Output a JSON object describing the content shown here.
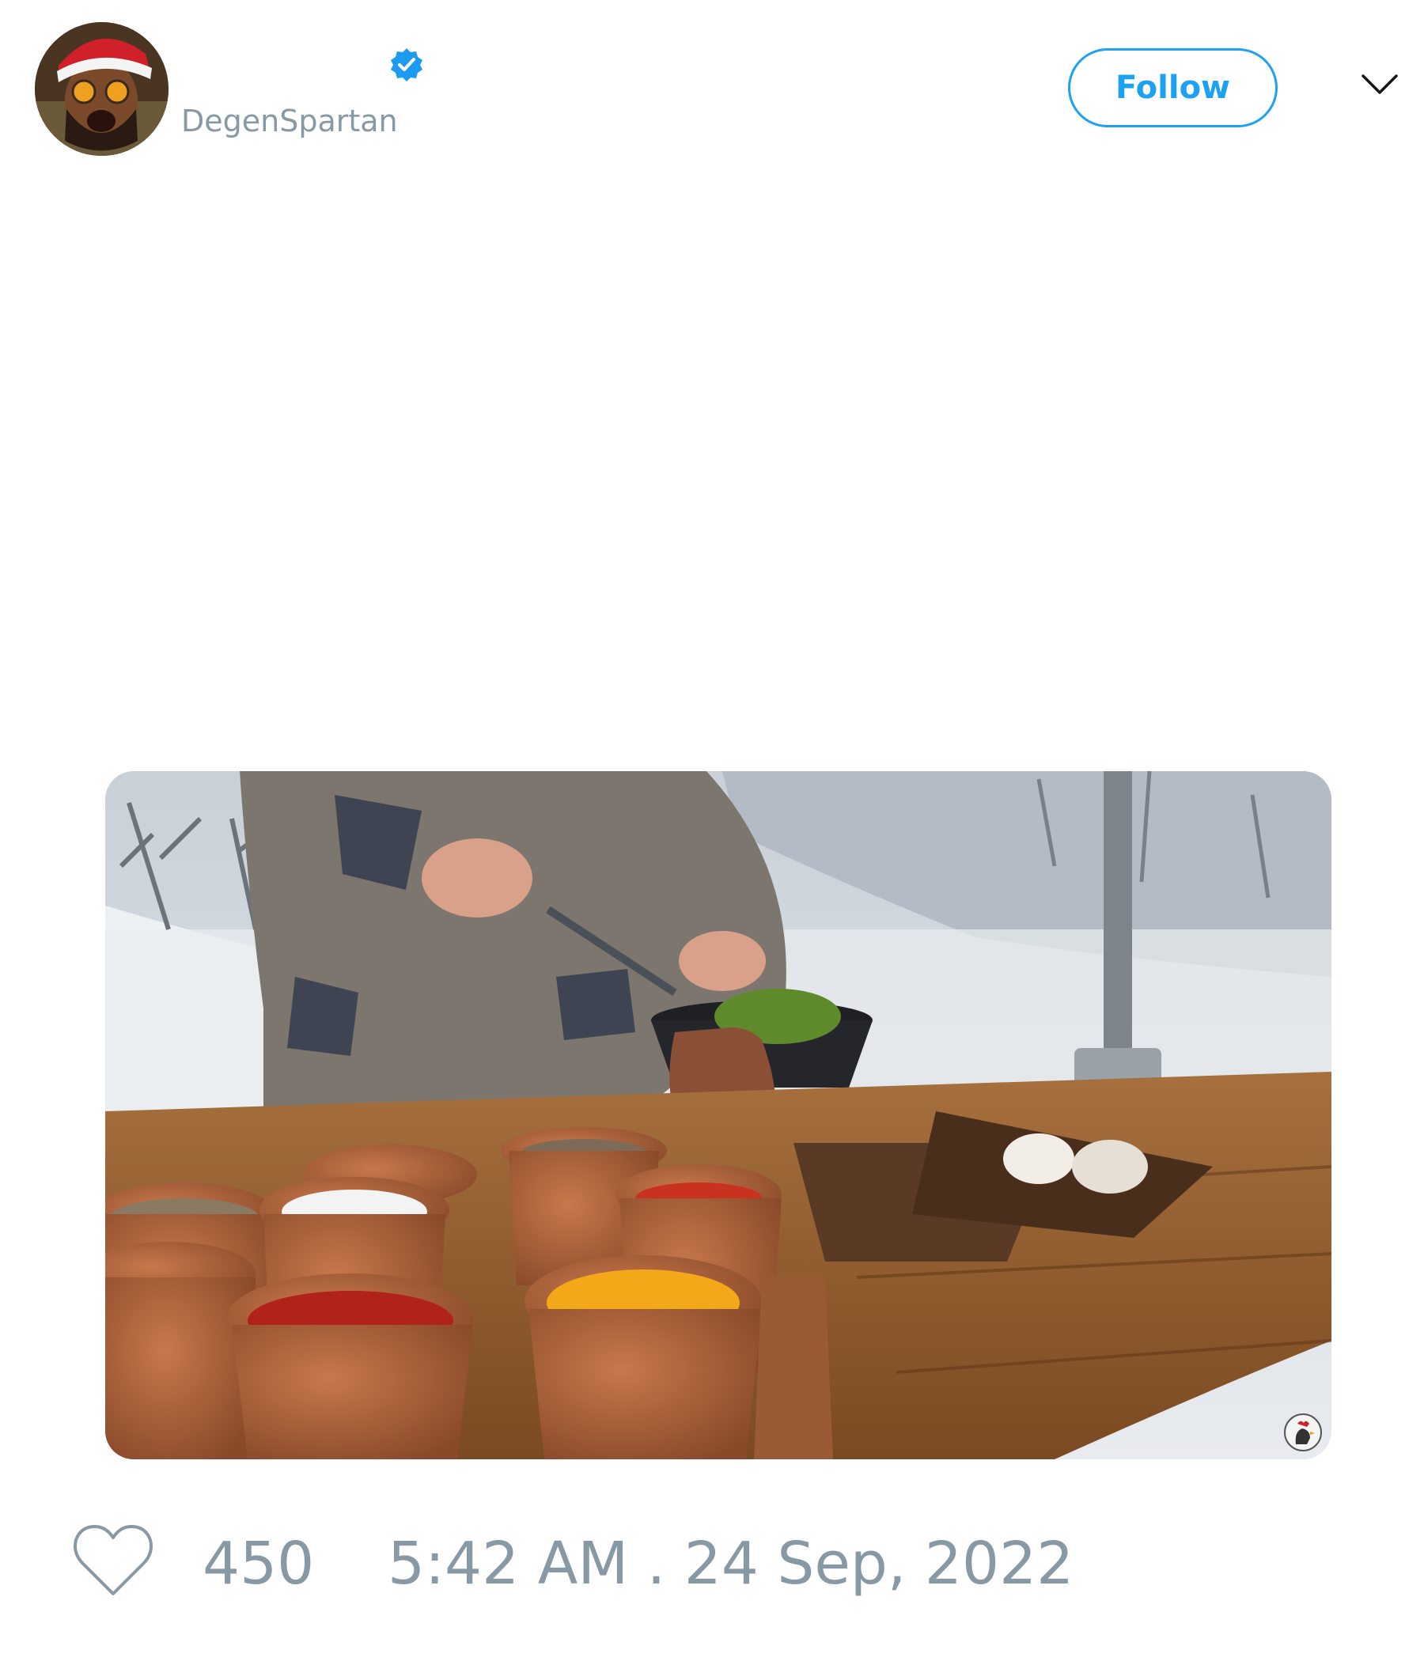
{
  "tweet": {
    "author": {
      "display_name": "",
      "handle": "DegenSpartan",
      "verified": true,
      "avatar_icon": "avatar-santa-hat"
    },
    "follow_label": "Follow",
    "menu_icon": "chevron-down-icon",
    "media": {
      "kind": "photo",
      "watermark_icon": "rooster-icon"
    },
    "likes": "450",
    "timestamp": "5:42 AM . 24 Sep, 2022"
  },
  "colors": {
    "accent": "#1da1f2",
    "muted_text": "#8899a6",
    "verified_badge": "#1d9bf0"
  }
}
